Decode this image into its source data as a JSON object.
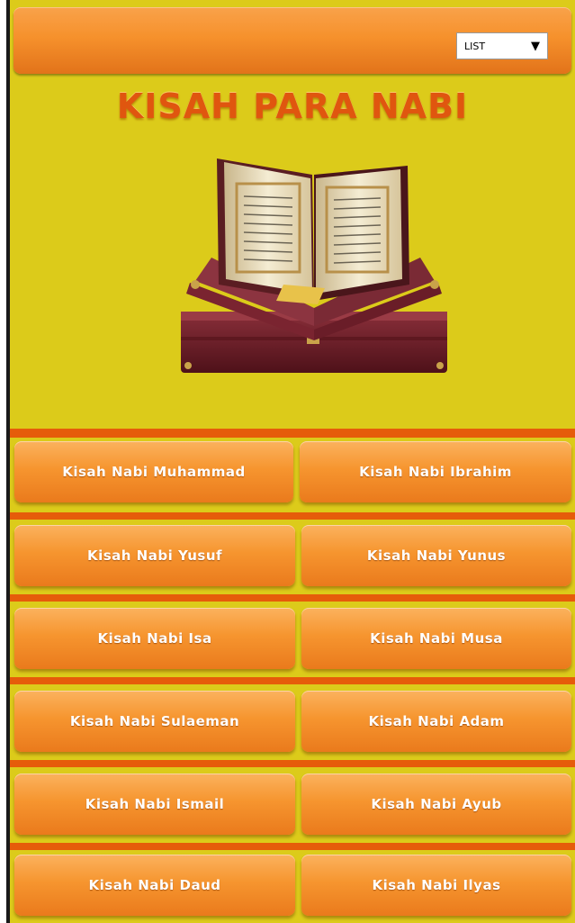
{
  "header": {
    "select_label": "LIST",
    "select_arrow": "▼"
  },
  "title": "KISAH PARA NABI",
  "image": {
    "icon": "open-quran-book-icon"
  },
  "buttons": [
    {
      "label": "Kisah Nabi Muhammad"
    },
    {
      "label": "Kisah Nabi Ibrahim"
    },
    {
      "label": "Kisah Nabi Yusuf"
    },
    {
      "label": "Kisah Nabi Yunus"
    },
    {
      "label": "Kisah Nabi Isa"
    },
    {
      "label": "Kisah Nabi Musa"
    },
    {
      "label": "Kisah Nabi Sulaeman"
    },
    {
      "label": "Kisah Nabi Adam"
    },
    {
      "label": "Kisah Nabi Ismail"
    },
    {
      "label": "Kisah Nabi Ayub"
    },
    {
      "label": "Kisah Nabi Daud"
    },
    {
      "label": "Kisah Nabi Ilyas"
    }
  ],
  "colors": {
    "background": "#dccb1a",
    "button": "#f6952f",
    "divider": "#e65c0a",
    "title": "#e0560f"
  }
}
